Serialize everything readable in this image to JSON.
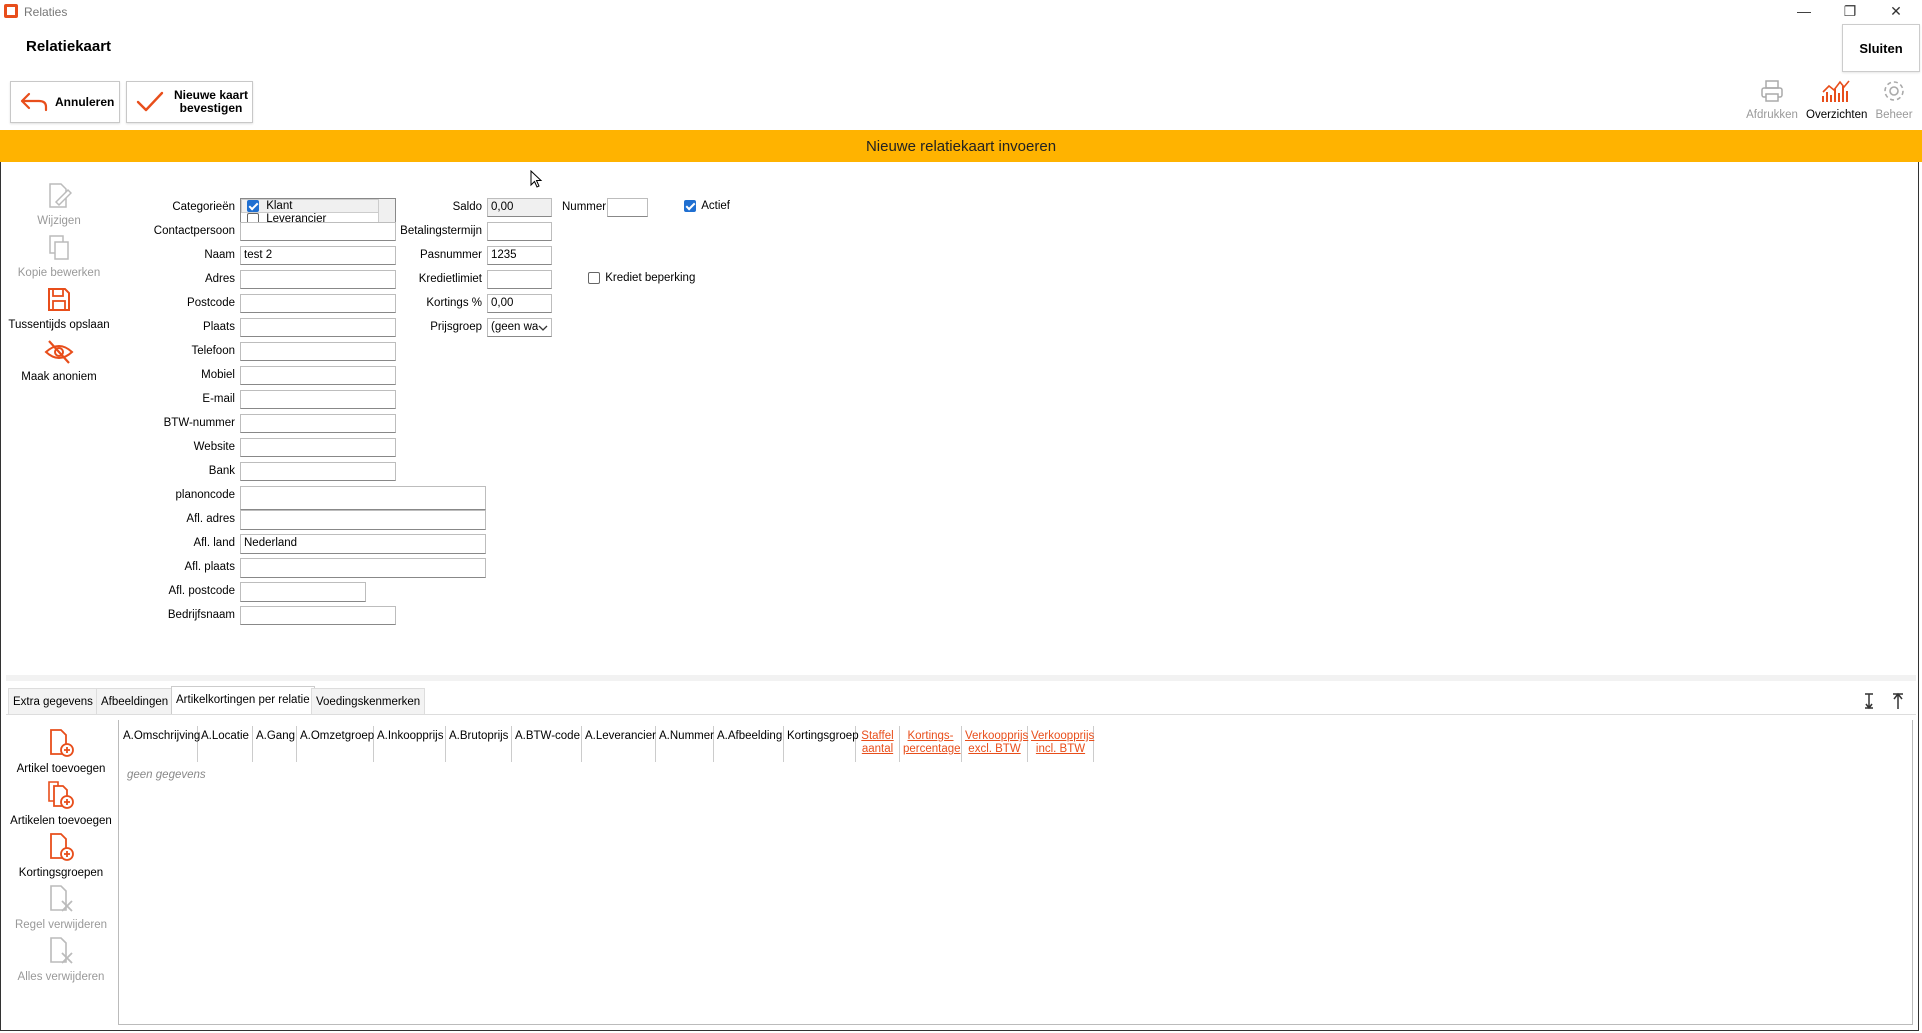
{
  "window": {
    "title": "Relaties",
    "minimize": "—",
    "restore": "❐",
    "close": "✕"
  },
  "page": {
    "title": "Relatiekaart",
    "close_button": "Sluiten",
    "cancel_button": "Annuleren",
    "confirm_button": "Nieuwe kaart bevestigen",
    "banner": "Nieuwe relatiekaart invoeren"
  },
  "toolbar": {
    "print": "Afdrukken",
    "overviews": "Overzichten",
    "manage": "Beheer"
  },
  "sidebar": {
    "edit": "Wijzigen",
    "copy_edit": "Kopie bewerken",
    "save_interim": "Tussentijds opslaan",
    "anonymize": "Maak anoniem"
  },
  "form": {
    "categories_label": "Categorieën",
    "categories": [
      {
        "label": "Klant",
        "checked": true
      },
      {
        "label": "Leverancier",
        "checked": false
      }
    ],
    "contact_label": "Contactpersoon",
    "contact_value": "",
    "name_label": "Naam",
    "name_value": "test 2",
    "address_label": "Adres",
    "address_value": "",
    "postcode_label": "Postcode",
    "postcode_value": "",
    "city_label": "Plaats",
    "city_value": "",
    "phone_label": "Telefoon",
    "phone_value": "",
    "mobile_label": "Mobiel",
    "mobile_value": "",
    "email_label": "E-mail",
    "email_value": "",
    "vat_label": "BTW-nummer",
    "vat_value": "",
    "website_label": "Website",
    "website_value": "",
    "bank_label": "Bank",
    "bank_value": "",
    "planon_label": "planoncode",
    "planon_value": "",
    "del_address_label": "Afl. adres",
    "del_address_value": "",
    "del_country_label": "Afl. land",
    "del_country_value": "Nederland",
    "del_city_label": "Afl. plaats",
    "del_city_value": "",
    "del_postcode_label": "Afl. postcode",
    "del_postcode_value": "",
    "company_label": "Bedrijfsnaam",
    "company_value": "",
    "balance_label": "Saldo",
    "balance_value": "0,00",
    "payment_term_label": "Betalingstermijn",
    "payment_term_value": "",
    "pass_number_label": "Pasnummer",
    "pass_number_value": "1235",
    "credit_limit_label": "Kredietlimiet",
    "credit_limit_value": "",
    "discount_label": "Kortings %",
    "discount_value": "0,00",
    "price_group_label": "Prijsgroep",
    "price_group_value": "(geen wa",
    "number_label": "Nummer",
    "number_value": "",
    "active_label": "Actief",
    "active_checked": true,
    "credit_restriction_label": "Krediet beperking",
    "credit_restriction_checked": false
  },
  "tabs": [
    {
      "label": "Extra gegevens",
      "active": false
    },
    {
      "label": "Afbeeldingen",
      "active": false
    },
    {
      "label": "Artikelkortingen per relatie",
      "active": true
    },
    {
      "label": "Voedingskenmerken",
      "active": false
    }
  ],
  "bottom_sidebar": {
    "add_article": "Artikel toevoegen",
    "add_articles": "Artikelen toevoegen",
    "discount_groups": "Kortingsgroepen",
    "delete_row": "Regel verwijderen",
    "delete_all": "Alles verwijderen"
  },
  "grid": {
    "columns": [
      {
        "l1": "A.Omschrijving",
        "l2": "",
        "red": false
      },
      {
        "l1": "A.Locatie",
        "l2": "",
        "red": false
      },
      {
        "l1": "A.Gang",
        "l2": "",
        "red": false
      },
      {
        "l1": "A.Omzetgroep",
        "l2": "",
        "red": false
      },
      {
        "l1": "A.Inkoopprijs",
        "l2": "",
        "red": false
      },
      {
        "l1": "A.Brutoprijs",
        "l2": "",
        "red": false
      },
      {
        "l1": "A.BTW-code",
        "l2": "",
        "red": false
      },
      {
        "l1": "A.Leverancier",
        "l2": "",
        "red": false
      },
      {
        "l1": "A.Nummer",
        "l2": "",
        "red": false
      },
      {
        "l1": "A.Afbeelding",
        "l2": "",
        "red": false
      },
      {
        "l1": "Kortingsgroep",
        "l2": "",
        "red": false
      },
      {
        "l1": "Staffel",
        "l2": "aantal",
        "red": true
      },
      {
        "l1": "Kortings-",
        "l2": "percentage",
        "red": true
      },
      {
        "l1": "Verkoopprijs",
        "l2": "excl. BTW",
        "red": true
      },
      {
        "l1": "Verkoopprijs",
        "l2": "incl. BTW",
        "red": true
      }
    ],
    "empty_text": "geen gegevens"
  },
  "colors": {
    "accent": "#e84e1b",
    "banner": "#ffb300",
    "checkbox": "#1f6fd1"
  }
}
